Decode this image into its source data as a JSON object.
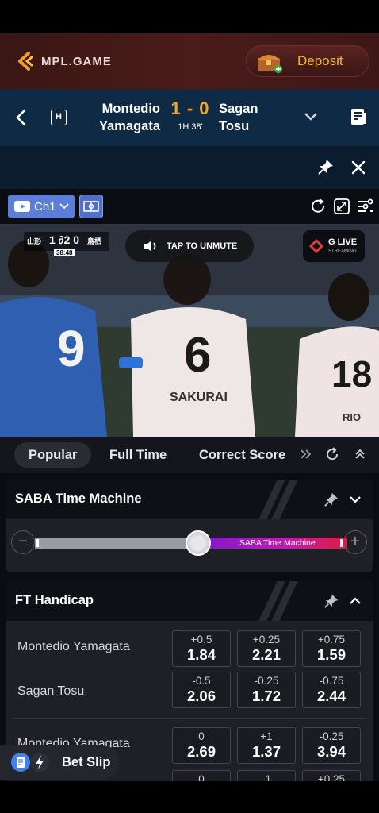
{
  "header": {
    "brand": "MPL.GAME",
    "deposit_label": "Deposit",
    "brand_color": "#f2b533"
  },
  "match": {
    "home_line1": "Montedio",
    "home_line2": "Yamagata",
    "away_line1": "Sagan",
    "away_line2": "Tosu",
    "score": "1 - 0",
    "time": "1H 38'",
    "home_badge": "H",
    "score_color": "#f5a623"
  },
  "stream": {
    "channel": "Ch1",
    "unmute": "TAP TO UNMUTE",
    "glive": "G LIVE",
    "glive_sub": "STREAMING",
    "overlay_home": "山形",
    "overlay_score": "1 ∂2 0",
    "overlay_away": "鳥栖",
    "overlay_clock": "38:48"
  },
  "tabs": [
    "Popular",
    "Full Time",
    "Correct Score"
  ],
  "time_machine": {
    "title": "SABA Time Machine",
    "slider_label": "SABA Time Machine",
    "position": 0.5
  },
  "ft_handicap": {
    "title": "FT Handicap",
    "groups": [
      {
        "rows": [
          {
            "team": "Montedio Yamagata",
            "odds": [
              {
                "line": "+0.5",
                "price": "1.84"
              },
              {
                "line": "+0.25",
                "price": "2.21"
              },
              {
                "line": "+0.75",
                "price": "1.59"
              }
            ]
          },
          {
            "team": "Sagan Tosu",
            "odds": [
              {
                "line": "-0.5",
                "price": "2.06"
              },
              {
                "line": "-0.25",
                "price": "1.72"
              },
              {
                "line": "-0.75",
                "price": "2.44"
              }
            ]
          }
        ]
      },
      {
        "rows": [
          {
            "team": "Montedio Yamagata",
            "odds": [
              {
                "line": "0",
                "price": "2.69"
              },
              {
                "line": "+1",
                "price": "1.37"
              },
              {
                "line": "-0.25",
                "price": "3.94"
              }
            ]
          },
          {
            "team": "",
            "odds": [
              {
                "line": "0",
                "price": ""
              },
              {
                "line": "-1",
                "price": ""
              },
              {
                "line": "+0.25",
                "price": ""
              }
            ]
          }
        ]
      }
    ]
  },
  "bet_slip": {
    "label": "Bet Slip"
  },
  "jerseys": {
    "left": "9",
    "center": "6",
    "center_name": "SAKURAI",
    "right": "18",
    "right_name": "RIO"
  }
}
